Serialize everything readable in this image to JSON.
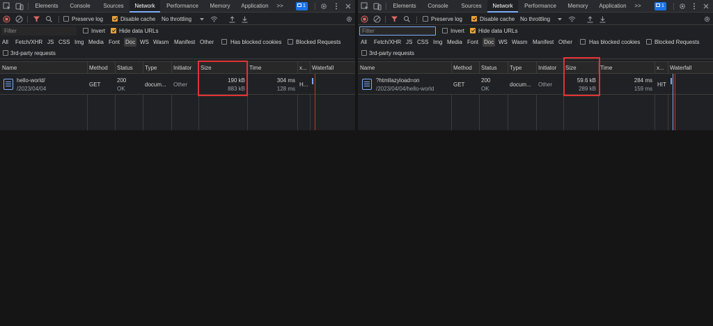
{
  "tabs": [
    "Elements",
    "Console",
    "Sources",
    "Network",
    "Performance",
    "Memory",
    "Application"
  ],
  "overflow_label": ">>",
  "issues_count": "1",
  "toolbar": {
    "preserve_log": "Preserve log",
    "disable_cache": "Disable cache",
    "throttling": "No throttling",
    "preserve_log_checked": false,
    "disable_cache_checked": true
  },
  "filter": {
    "placeholder": "Filter",
    "invert": "Invert",
    "hide_data_urls": "Hide data URLs",
    "invert_checked": false,
    "hide_data_urls_checked": true
  },
  "types": [
    "All",
    "Fetch/XHR",
    "JS",
    "CSS",
    "Img",
    "Media",
    "Font",
    "Doc",
    "WS",
    "Wasm",
    "Manifest",
    "Other"
  ],
  "active_type": "Doc",
  "has_blocked_cookies": "Has blocked cookies",
  "blocked_requests": "Blocked Requests",
  "third_party": "3rd-party requests",
  "columns": {
    "name": "Name",
    "method": "Method",
    "status": "Status",
    "type": "Type",
    "initiator": "Initiator",
    "size": "Size",
    "time": "Time",
    "x": "x...",
    "waterfall": "Waterfall"
  },
  "left_panel": {
    "row": {
      "name": "hello-world/",
      "path": "/2023/04/04",
      "method": "GET",
      "status_code": "200",
      "status_text": "OK",
      "type": "docum...",
      "initiator": "Other",
      "size_transferred": "190 kB",
      "size_resource": "883 kB",
      "time": "304 ms",
      "time_latency": "128 ms",
      "x": "H..."
    }
  },
  "right_panel": {
    "row": {
      "name": "?htmllazyload=on",
      "path": "/2023/04/04/hello-world",
      "method": "GET",
      "status_code": "200",
      "status_text": "OK",
      "type": "docum...",
      "initiator": "Other",
      "size_transferred": "59.6 kB",
      "size_resource": "289 kB",
      "time": "284 ms",
      "time_latency": "159 ms",
      "x": "HIT"
    }
  },
  "colors": {
    "accent": "#7cacf8",
    "record": "#e46962",
    "filter_funnel": "#e46962",
    "checkbox": "#e8a23a",
    "highlight": "#e23232"
  }
}
